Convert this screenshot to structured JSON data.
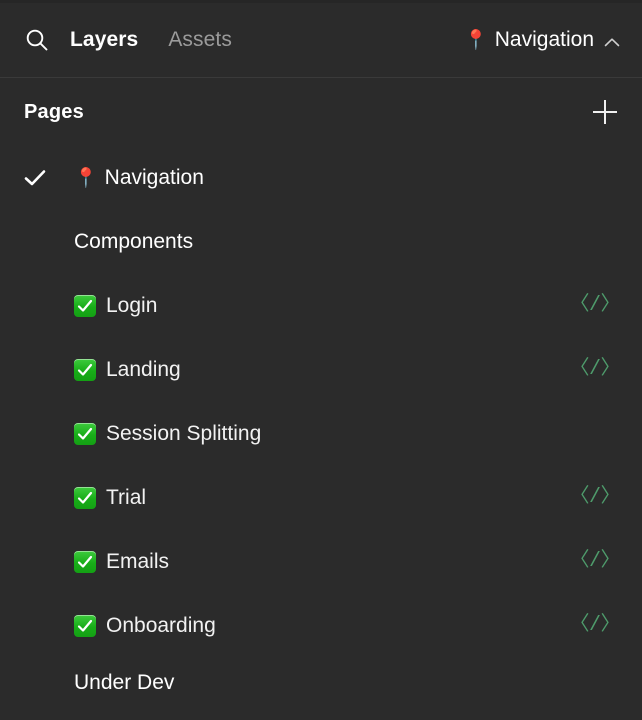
{
  "header": {
    "search_icon": "search-icon",
    "tabs": [
      {
        "label": "Layers",
        "active": true
      },
      {
        "label": "Assets",
        "active": false
      }
    ],
    "page_selector": {
      "pin_icon": "📍",
      "label": "Navigation",
      "chevron": "chevron-up-icon"
    }
  },
  "pages_section": {
    "title": "Pages",
    "add_button": "plus-icon"
  },
  "tree": {
    "page": {
      "selected_check": "check-icon",
      "pin_icon": "📍",
      "label": "Navigation"
    },
    "groups": [
      {
        "label": "Components",
        "items": [
          {
            "label": "Login",
            "checked": true,
            "has_code": true
          },
          {
            "label": "Landing",
            "checked": true,
            "has_code": true
          },
          {
            "label": "Session Splitting",
            "checked": true,
            "has_code": false
          },
          {
            "label": "Trial",
            "checked": true,
            "has_code": true
          },
          {
            "label": "Emails",
            "checked": true,
            "has_code": true
          },
          {
            "label": "Onboarding",
            "checked": true,
            "has_code": true
          }
        ]
      },
      {
        "label": "Under Dev",
        "items": []
      }
    ],
    "code_icon_glyph": "〈/〉"
  },
  "colors": {
    "background": "#2b2b2b",
    "text_primary": "#ffffff",
    "text_muted": "#9b9b9b",
    "divider": "#3a3a3a",
    "checkbox_green": "#1ead1e",
    "code_icon_green": "#4e9b6b",
    "pin_red": "#e03131"
  }
}
